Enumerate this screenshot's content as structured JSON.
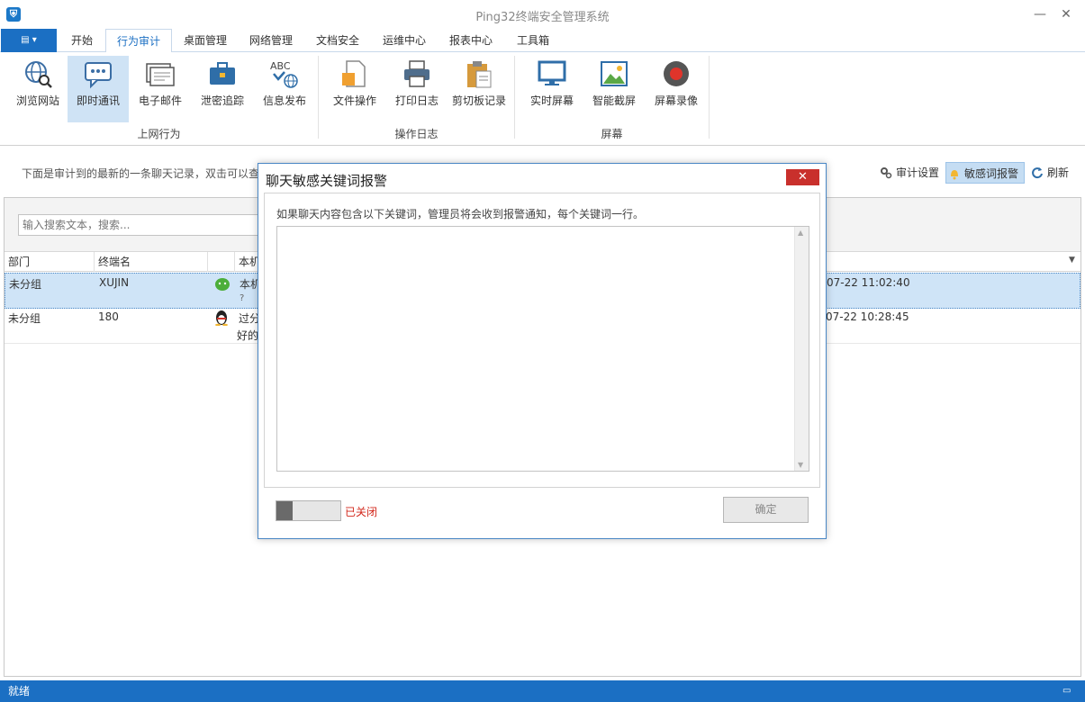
{
  "window": {
    "title": "Ping32终端安全管理系统",
    "min": "—",
    "max": "☐",
    "close": "✕"
  },
  "menu": {
    "file_label": "▤ ▾",
    "tabs": [
      "开始",
      "行为审计",
      "桌面管理",
      "网络管理",
      "文档安全",
      "运维中心",
      "报表中心",
      "工具箱"
    ]
  },
  "ribbon": {
    "buttons": [
      "浏览网站",
      "即时通讯",
      "电子邮件",
      "泄密追踪",
      "信息发布",
      "文件操作",
      "打印日志",
      "剪切板记录",
      "实时屏幕",
      "智能截屏",
      "屏幕录像"
    ],
    "groups": [
      "上网行为",
      "操作日志",
      "屏幕"
    ]
  },
  "toolbar": {
    "hint": "下面是审计到的最新的一条聊天记录，双击可以查",
    "audit_settings": "审计设置",
    "sensitive_alert": "敏感词报警",
    "refresh": "刷新"
  },
  "search": {
    "placeholder": "输入搜索文本，搜索..."
  },
  "grid": {
    "headers": [
      "部门",
      "终端名",
      "",
      "本机"
    ],
    "rows": [
      {
        "dept": "未分组",
        "terminal": "XUJIN",
        "msg1": "本机",
        "msg2": "?",
        "time": "07-22 11:02:40"
      },
      {
        "dept": "未分组",
        "terminal": "180",
        "msg1": "过分",
        "msg2": "好的",
        "time": "07-22 10:28:45"
      }
    ]
  },
  "dialog": {
    "title": "聊天敏感关键词报警",
    "close": "✕",
    "description": "如果聊天内容包含以下关键词，管理员将会收到报警通知，每个关键词一行。",
    "toggle_state": "已关闭",
    "ok": "确定"
  },
  "status": {
    "text": "就绪"
  },
  "colors": {
    "accent": "#1b6fc3",
    "selected": "#cfe4f7",
    "alert_red": "#d2271b"
  }
}
